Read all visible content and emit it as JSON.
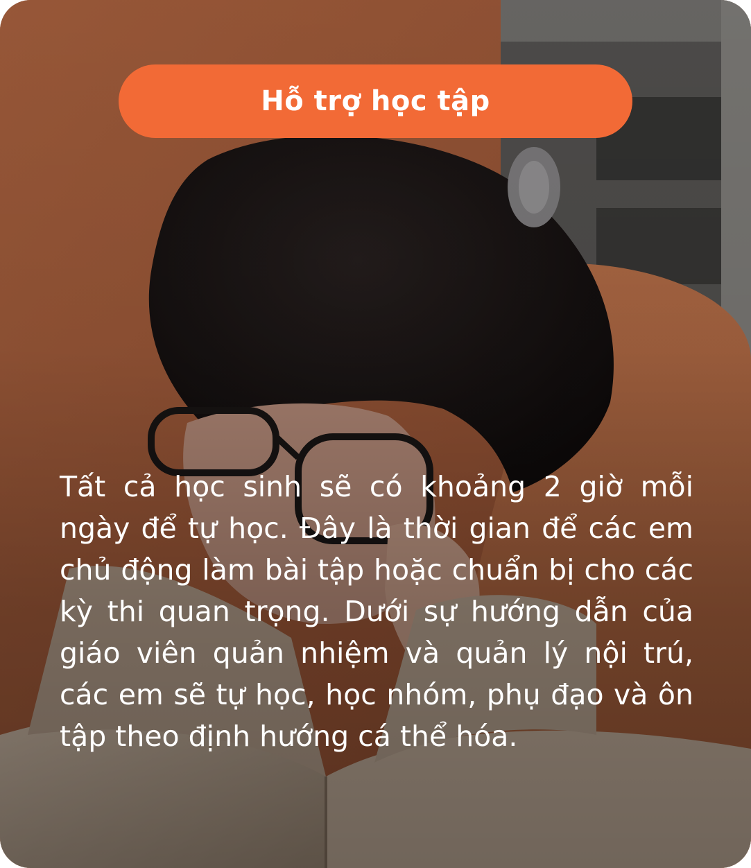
{
  "badge": {
    "label": "Hỗ trợ học tập"
  },
  "content": {
    "paragraph": "Tất cả học sinh sẽ có khoảng 2 giờ mỗi ngày để tự học. Đây là thời gian để các em chủ động làm bài tập hoặc chuẩn bị cho các kỳ thi quan trọng. Dưới sự hướng dẫn của giáo viên quản nhiệm và quản lý nội trú, các em sẽ tự học, học nhóm, phụ đạo và ôn tập theo định hướng cá thể hóa."
  },
  "colors": {
    "accent": "#f26a36",
    "text": "#ffffff"
  }
}
